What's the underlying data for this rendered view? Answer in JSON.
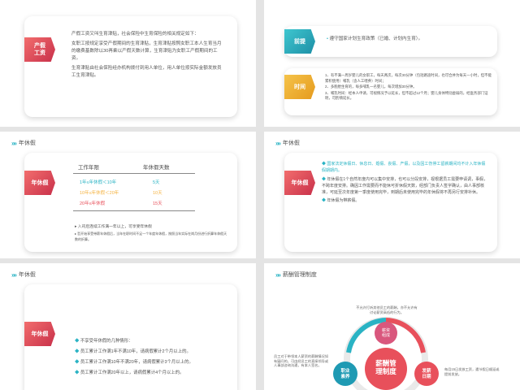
{
  "slide1": {
    "tag": "产假\n工资",
    "paras": [
      "产假工资又叫生育津贴，社会保险中生育保险的相关规定如下：",
      "女职工按规定享受产假期间的生育津贴，生育津贴按照女职工本人生育当月的缴费基数除以30再乘以产假天数计算，生育津贴为女职工产假期间的工资。",
      "生育津贴由社会保险经办机构拨付到用人单位，用人单位按实际金额发放员工生育津贴。"
    ]
  },
  "slide2": {
    "tag1": "前提",
    "premise": "遵守国家计划生育政策（已婚、计划内生育）。",
    "tag2": "时间",
    "items": [
      "1、有不满一周岁婴儿的女职工，每天两次，每次30分钟（包括路途时间，也可合并为每天一小时，但不能累积使用）哺乳（含人工喂养）时间；",
      "2、多胞胎生育的，每多哺乳一名婴儿，每次增加30分钟。",
      "3、哺乳时间：经本人申请，可视情况予以延长，但不超过12个月；婴儿身体特别虚弱的，经医务部门证明，可酌情延长。"
    ]
  },
  "slide3": {
    "header": "年休假",
    "tag": "年休假",
    "col1": "工作年限",
    "col2": "年休假天数",
    "rows": [
      {
        "years": "1年≤年休假＜10年",
        "days": "5天",
        "color": "#2ab3c4"
      },
      {
        "years": "10年≤年休假＜20年",
        "days": "10天",
        "color": "#f5b342"
      },
      {
        "years": "20年≤年休假",
        "days": "15天",
        "color": "#e8505b"
      }
    ],
    "note1": "入司后连续工作满一年以上，可享受年休假",
    "note2": "哲开始享受带薪年休假后，当年在职时间不足一个年度年休假，按照当年实际在岗月份进行折算年休假天数的折算。"
  },
  "slide4": {
    "header": "年休假",
    "tag": "年休假",
    "items": [
      "国家法定休假日、休息日、婚假、丧假、产假，以及因工伤停工留薪期间均不计入年休假假期期内。",
      "年休假在1个自然年度内可以集中安排，也可以分段安排，视根据员工需要申请调，事假，不跨年度安排。确因工作需要而不能休可折休假天数，经部门负责人签字确认，由人事部核准，可延至次年度第一季度使用完毕，到期后未使用完毕的年休假将不再另行安排补休。",
      "年休假为带薪假。"
    ]
  },
  "slide5": {
    "header": "年休假",
    "tag": "年休假",
    "items": [
      "不享受年休假的几种情形：",
      "员工累计工作满1年不满10年，请病假累计2个月以上的。",
      "员工累计工作满10年不满20年，请病假累计3个月以上的。",
      "员工累计工作满20年以上，请病假累计4个月以上的。"
    ]
  },
  "slide6": {
    "header": "薪酬管理制度",
    "center": "薪酬管\n理制度",
    "node_top": "薪资\n组成",
    "node_left": "职业\n素养",
    "node_right": "发薪\n日期",
    "text_top": "不允许打听其他员工的薪酬，亦不允许有讨论薪资高低的行为。",
    "text_left": "员工对于带领本人薪资的薪酬情况如有疑问的，可由经员工的直接领导或人事部咨询沟通，有本人签名。",
    "text_right": "每月15日发放工资，遇节假日顺延或提前发放。"
  }
}
